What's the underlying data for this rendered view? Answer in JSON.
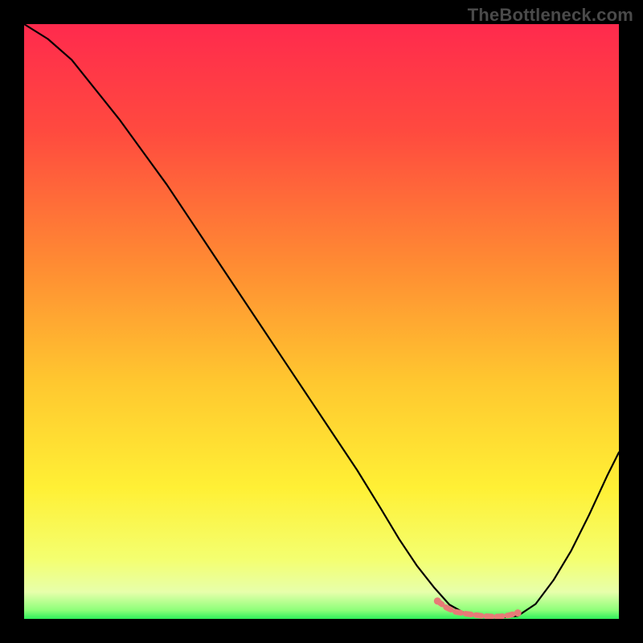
{
  "watermark": "TheBottleneck.com",
  "colors": {
    "bg_outer": "#000000",
    "grad_top": "#ff2a4d",
    "grad_mid_upper": "#ff6a3a",
    "grad_mid": "#ffb030",
    "grad_mid_lower": "#ffe733",
    "grad_lower": "#f7ff55",
    "grad_bottom_band": "#eaff9a",
    "grad_bottom": "#2fef5a",
    "curve": "#000000",
    "marker": "#e77a77"
  },
  "chart_data": {
    "type": "line",
    "title": "",
    "xlabel": "",
    "ylabel": "",
    "xlim": [
      0,
      100
    ],
    "ylim": [
      0,
      100
    ],
    "series": [
      {
        "name": "bottleneck-curve",
        "x": [
          0,
          4,
          8,
          12,
          16,
          20,
          24,
          28,
          32,
          36,
          40,
          44,
          48,
          52,
          56,
          60,
          63,
          66,
          69,
          71.5,
          74,
          76,
          78.5,
          81,
          83,
          86,
          89,
          92,
          95,
          98,
          100
        ],
        "y": [
          100,
          97.5,
          94,
          89,
          84,
          78.5,
          73,
          67,
          61,
          55,
          49,
          43,
          37,
          31,
          25,
          18.5,
          13.5,
          9,
          5.2,
          2.4,
          1,
          0.5,
          0.3,
          0.3,
          0.5,
          2.5,
          6.5,
          11.5,
          17.5,
          24,
          28
        ]
      }
    ],
    "markers": {
      "name": "trough-markers",
      "x": [
        69.5,
        71,
        72.5,
        74,
        75.5,
        77,
        78.5,
        80,
        81.5,
        83
      ],
      "y": [
        3.0,
        1.9,
        1.2,
        0.9,
        0.7,
        0.5,
        0.4,
        0.4,
        0.6,
        1.0
      ]
    },
    "gradient_stops": [
      {
        "offset": 0.0,
        "color": "#ff2a4d"
      },
      {
        "offset": 0.18,
        "color": "#ff4a3f"
      },
      {
        "offset": 0.4,
        "color": "#ff8a33"
      },
      {
        "offset": 0.6,
        "color": "#ffc72f"
      },
      {
        "offset": 0.78,
        "color": "#fff035"
      },
      {
        "offset": 0.9,
        "color": "#f4ff70"
      },
      {
        "offset": 0.955,
        "color": "#e7ffab"
      },
      {
        "offset": 0.985,
        "color": "#8fff7a"
      },
      {
        "offset": 1.0,
        "color": "#2fef5a"
      }
    ]
  }
}
